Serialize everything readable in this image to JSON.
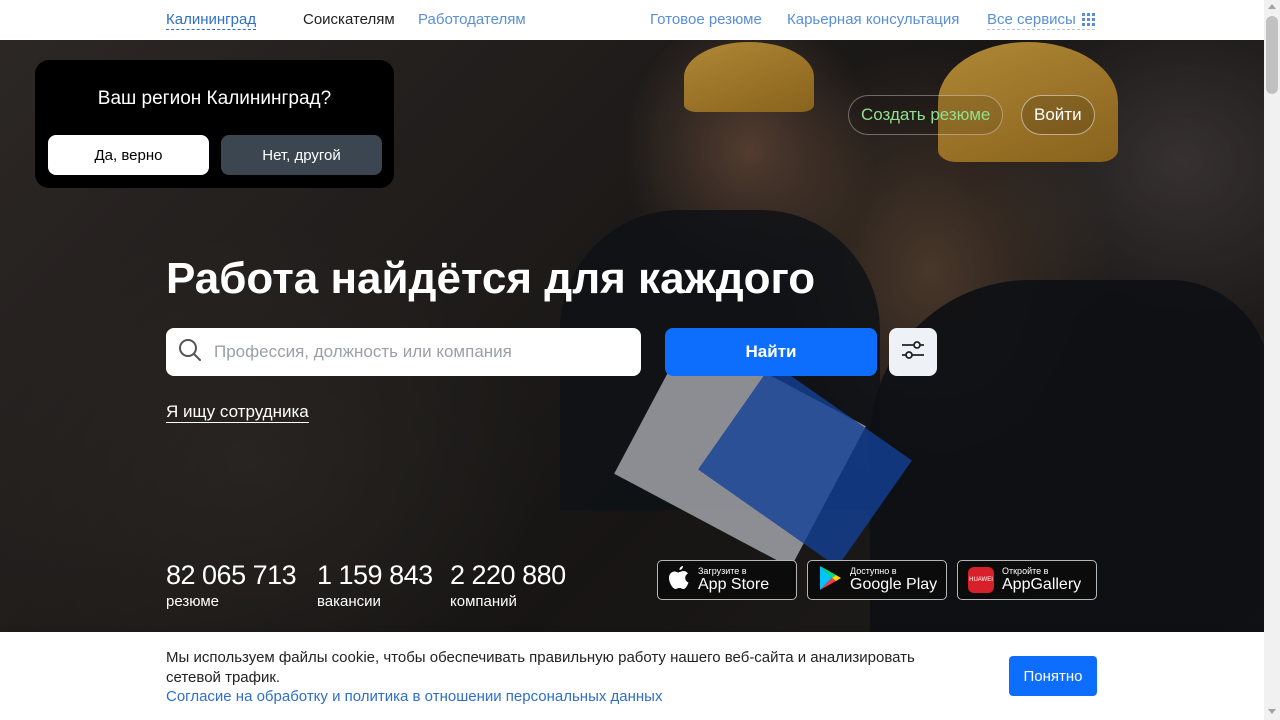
{
  "nav": {
    "city": "Калининград",
    "seekers": "Соискателям",
    "employers": "Работодателям",
    "ready_resume": "Готовое резюме",
    "career_consult": "Карьерная консультация",
    "all_services": "Все сервисы"
  },
  "region_popup": {
    "question": "Ваш регион Калининград?",
    "yes_label": "Да, верно",
    "no_label": "Нет, другой"
  },
  "header_actions": {
    "create_resume": "Создать резюме",
    "login": "Войти"
  },
  "hero": {
    "headline": "Работа найдётся для каждого",
    "search_placeholder": "Профессия, должность или компания",
    "find_label": "Найти",
    "employer_link": "Я ищу сотрудника"
  },
  "stats": [
    {
      "value": "82 065 713",
      "label": "резюме"
    },
    {
      "value": "1 159 843",
      "label": "вакансии"
    },
    {
      "value": "2 220 880",
      "label": "компаний"
    }
  ],
  "stores": [
    {
      "small": "Загрузите в",
      "big": "App Store",
      "icon": "apple-icon"
    },
    {
      "small": "Доступно в",
      "big": "Google Play",
      "icon": "google-play-icon"
    },
    {
      "small": "Откройте в",
      "big": "AppGallery",
      "icon": "huawei-icon",
      "icon_text": "HUAWEI"
    }
  ],
  "cookie": {
    "text": "Мы используем файлы cookie, чтобы обеспечивать правильную работу нашего веб-сайта и анализировать сетевой трафик.",
    "link": "Согласие на обработку и политика в отношении персональных данных",
    "ok_label": "Понятно"
  },
  "colors": {
    "primary": "#0d6efd",
    "link": "#2f6ec9",
    "create_resume": "#8fe08f",
    "popup_bg": "#000000"
  }
}
